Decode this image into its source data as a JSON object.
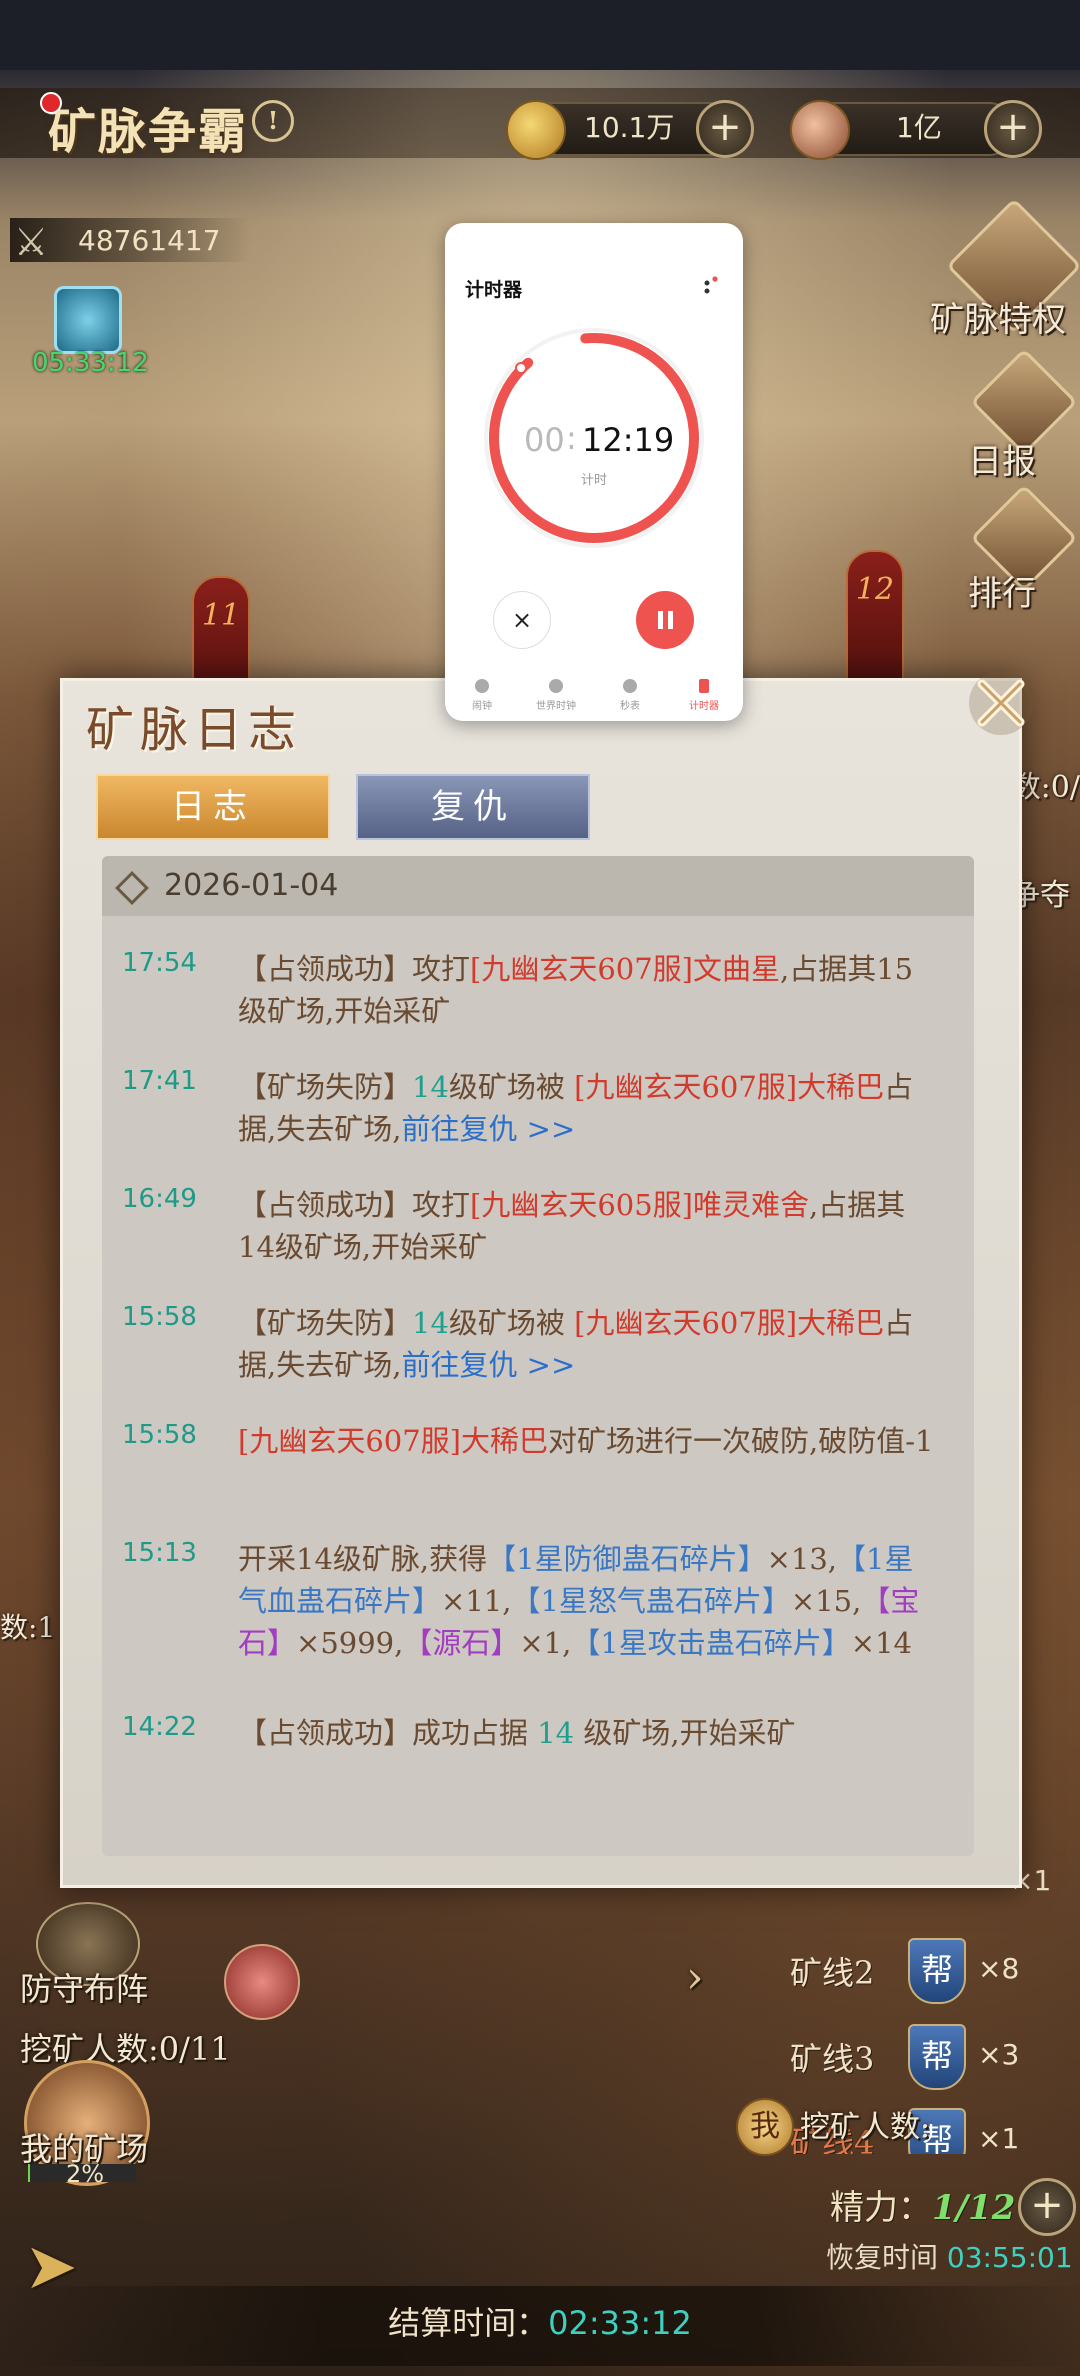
{
  "game": {
    "title": "矿脉争霸",
    "resource_gold": "10.1万",
    "resource_coin": "1亿",
    "power": "48761417",
    "buff_timer": "05:33:12"
  },
  "side_menu": [
    "矿脉特权",
    "日报",
    "排行"
  ],
  "side_fragments": [
    "数:0/",
    "争夺",
    "数:1"
  ],
  "banners": [
    "11",
    "12"
  ],
  "bottom": {
    "defense": "防守布阵",
    "miners": "挖矿人数:0/11",
    "my_mine": "我的矿场",
    "my_mine_progress": "2%",
    "my_mine_progress_value": 0.02,
    "mine_lines": [
      {
        "label": "矿线2",
        "badge": "帮",
        "count": "×8"
      },
      {
        "label": "矿线3",
        "badge": "帮",
        "count": "×3"
      },
      {
        "label": "矿线4",
        "badge": "帮",
        "count": "×1"
      }
    ],
    "mine_line_top_count": "×1",
    "me_badge": "我",
    "me_miners": "挖矿人数:",
    "stamina_label": "精力：",
    "stamina_value": "1/12",
    "recover_label": "恢复时间",
    "recover_time": "03:55:01",
    "settle_label": "结算时间：",
    "settle_time": "02:33:12"
  },
  "log_panel": {
    "title": "矿脉日志",
    "tab_log": "日志",
    "tab_revenge": "复仇",
    "date": "2026-01-04",
    "entries": [
      {
        "time": "17:54",
        "parts": [
          [
            "【占领成功】攻打",
            ""
          ],
          [
            "[九幽玄天607服]文曲星",
            "red"
          ],
          [
            ",占据其15级矿场,开始采矿",
            ""
          ]
        ]
      },
      {
        "time": "17:41",
        "parts": [
          [
            "【矿场失防】",
            ""
          ],
          [
            "14",
            "teal"
          ],
          [
            "级矿场被 ",
            ""
          ],
          [
            "[九幽玄天607服]大稀巴",
            "red"
          ],
          [
            "占据,失去矿场,",
            ""
          ],
          [
            "前往复仇 >>",
            "blue"
          ]
        ]
      },
      {
        "time": "16:49",
        "parts": [
          [
            "【占领成功】攻打",
            ""
          ],
          [
            "[九幽玄天605服]唯灵难舍",
            "red"
          ],
          [
            ",占据其14级矿场,开始采矿",
            ""
          ]
        ]
      },
      {
        "time": "15:58",
        "parts": [
          [
            "【矿场失防】",
            ""
          ],
          [
            "14",
            "teal"
          ],
          [
            "级矿场被 ",
            ""
          ],
          [
            "[九幽玄天607服]大稀巴",
            "red"
          ],
          [
            "占据,失去矿场,",
            ""
          ],
          [
            "前往复仇 >>",
            "blue"
          ]
        ]
      },
      {
        "time": "15:58",
        "parts": [
          [
            "[九幽玄天607服]大稀巴",
            "red"
          ],
          [
            "对矿场进行一次破防,破防值-1",
            ""
          ]
        ]
      },
      {
        "time": "15:13",
        "parts": [
          [
            "开采14级矿脉,获得",
            ""
          ],
          [
            "【1星防御蛊石碎片】",
            "lblue"
          ],
          [
            "×13,",
            ""
          ],
          [
            "【1星气血蛊石碎片】",
            "lblue"
          ],
          [
            "×11,",
            ""
          ],
          [
            "【1星怒气蛊石碎片】",
            "lblue"
          ],
          [
            "×15,",
            ""
          ],
          [
            "【宝石】",
            "purple"
          ],
          [
            "×5999,",
            ""
          ],
          [
            "【源石】",
            "purple"
          ],
          [
            "×1,",
            ""
          ],
          [
            "【1星攻击蛊石碎片】",
            "lblue"
          ],
          [
            "×14",
            ""
          ]
        ]
      },
      {
        "time": "14:22",
        "parts": [
          [
            "【占领成功】成功占据 ",
            ""
          ],
          [
            "14",
            "teal"
          ],
          [
            " 级矿场,开始采矿",
            ""
          ]
        ]
      }
    ]
  },
  "timer": {
    "title": "计时器",
    "minutes": "00",
    "hours_seconds": "12:19",
    "sub_label": "计时",
    "cancel_symbol": "×",
    "nav": [
      "闹钟",
      "世界时钟",
      "秒表",
      "计时器"
    ],
    "accent": "#ef5350"
  }
}
